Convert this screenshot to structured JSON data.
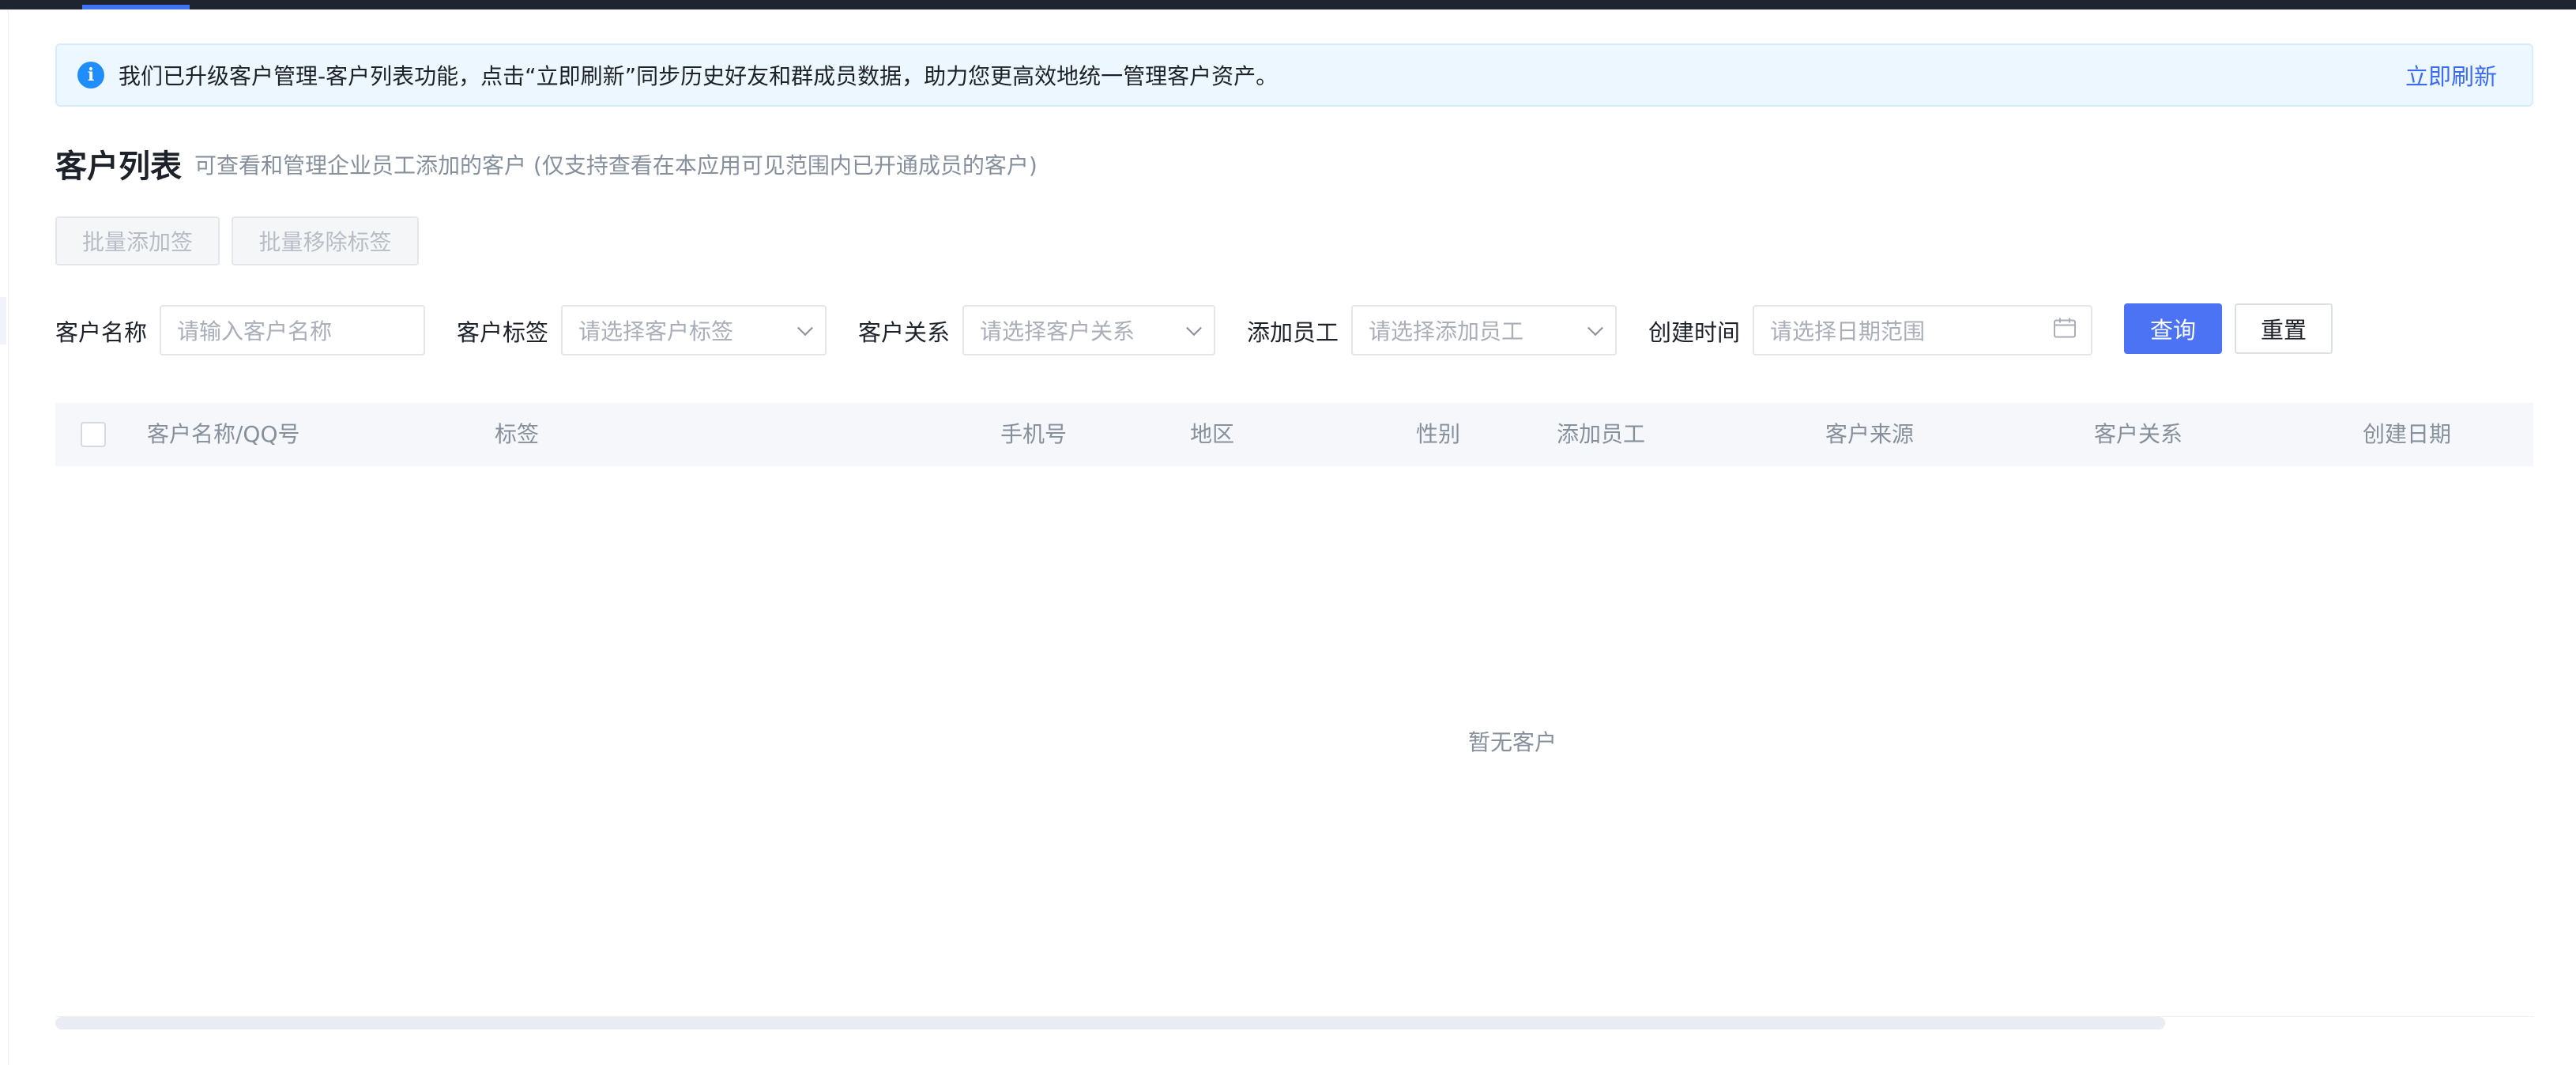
{
  "notice": {
    "icon": "info-icon",
    "text": "我们已升级客户管理-客户列表功能，点击“立即刷新”同步历史好友和群成员数据，助力您更高效地统一管理客户资产。",
    "action_label": "立即刷新"
  },
  "page": {
    "title": "客户列表",
    "subtitle": "可查看和管理企业员工添加的客户 (仅支持查看在本应用可见范围内已开通成员的客户)"
  },
  "batch_actions": {
    "add_tag_label": "批量添加签",
    "remove_tag_label": "批量移除标签"
  },
  "filters": {
    "customer_name": {
      "label": "客户名称",
      "placeholder": "请输入客户名称"
    },
    "customer_tag": {
      "label": "客户标签",
      "placeholder": "请选择客户标签"
    },
    "customer_relation": {
      "label": "客户关系",
      "placeholder": "请选择客户关系"
    },
    "added_staff": {
      "label": "添加员工",
      "placeholder": "请选择添加员工"
    },
    "created_time": {
      "label": "创建时间",
      "placeholder": "请选择日期范围"
    },
    "query_label": "查询",
    "reset_label": "重置"
  },
  "table": {
    "columns": [
      "客户名称/QQ号",
      "标签",
      "手机号",
      "地区",
      "性别",
      "添加员工",
      "客户来源",
      "客户关系",
      "创建日期"
    ],
    "empty_text": "暂无客户"
  },
  "colors": {
    "primary": "#4b73f4",
    "link": "#3d6cf4",
    "info": "#1f8efa",
    "topbar": "#1f2530"
  }
}
